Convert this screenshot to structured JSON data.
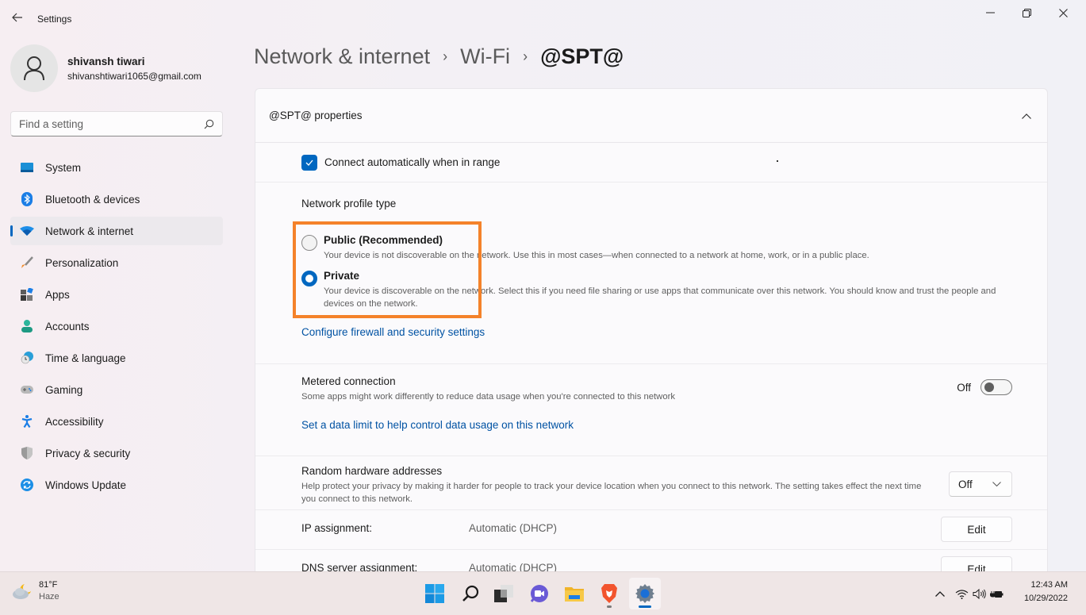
{
  "window": {
    "app_title": "Settings",
    "controls": {
      "minimize": "minimize",
      "maximize": "restore",
      "close": "close"
    }
  },
  "profile": {
    "name": "shivansh tiwari",
    "email": "shivanshtiwari1065@gmail.com"
  },
  "search": {
    "placeholder": "Find a setting",
    "value": ""
  },
  "sidebar": {
    "items": [
      {
        "label": "System",
        "icon": "monitor-icon",
        "active": false
      },
      {
        "label": "Bluetooth & devices",
        "icon": "bluetooth-icon",
        "active": false
      },
      {
        "label": "Network & internet",
        "icon": "wifi-icon",
        "active": true
      },
      {
        "label": "Personalization",
        "icon": "brush-icon",
        "active": false
      },
      {
        "label": "Apps",
        "icon": "apps-icon",
        "active": false
      },
      {
        "label": "Accounts",
        "icon": "person-icon",
        "active": false
      },
      {
        "label": "Time & language",
        "icon": "clock-globe-icon",
        "active": false
      },
      {
        "label": "Gaming",
        "icon": "gamepad-icon",
        "active": false
      },
      {
        "label": "Accessibility",
        "icon": "accessibility-icon",
        "active": false
      },
      {
        "label": "Privacy & security",
        "icon": "shield-icon",
        "active": false
      },
      {
        "label": "Windows Update",
        "icon": "update-icon",
        "active": false
      }
    ]
  },
  "breadcrumb": {
    "items": [
      "Network & internet",
      "Wi-Fi"
    ],
    "current": "@SPT@",
    "separator": "›"
  },
  "properties": {
    "title": "@SPT@ properties",
    "connect_auto": {
      "label": "Connect automatically when in range",
      "checked": true
    },
    "network_profile": {
      "title": "Network profile type",
      "options": [
        {
          "label": "Public (Recommended)",
          "desc": "Your device is not discoverable on the network. Use this in most cases—when connected to a network at home, work, or in a public place.",
          "selected": false
        },
        {
          "label": "Private",
          "desc": "Your device is discoverable on the network. Select this if you need file sharing or use apps that communicate over this network. You should know and trust the people and devices on the network.",
          "selected": true
        }
      ],
      "firewall_link": "Configure firewall and security settings"
    },
    "metered": {
      "title": "Metered connection",
      "desc": "Some apps might work differently to reduce data usage when you're connected to this network",
      "state_label": "Off",
      "on": false,
      "data_limit_link": "Set a data limit to help control data usage on this network"
    },
    "random_hw": {
      "title": "Random hardware addresses",
      "desc": "Help protect your privacy by making it harder for people to track your device location when you connect to this network. The setting takes effect the next time you connect to this network.",
      "value": "Off"
    },
    "ip_assignment": {
      "label": "IP assignment:",
      "value": "Automatic (DHCP)",
      "button": "Edit"
    },
    "dns_assignment": {
      "label": "DNS server assignment:",
      "value": "Automatic (DHCP)",
      "button": "Edit"
    }
  },
  "highlight": {
    "color": "#f4822a",
    "target": "network-profile-options"
  },
  "colors": {
    "accent": "#0067c0",
    "link": "#0052a3"
  },
  "taskbar": {
    "weather": {
      "temp": "81°F",
      "condition": "Haze"
    },
    "apps": [
      "start-icon",
      "search-icon",
      "task-view-icon",
      "teams-chat-icon",
      "file-explorer-icon",
      "brave-browser-icon",
      "settings-icon"
    ],
    "tray": [
      "chevron-up-icon",
      "wifi-icon",
      "speaker-icon",
      "battery-charging-icon"
    ],
    "time": "12:43 AM",
    "date": "10/29/2022"
  }
}
